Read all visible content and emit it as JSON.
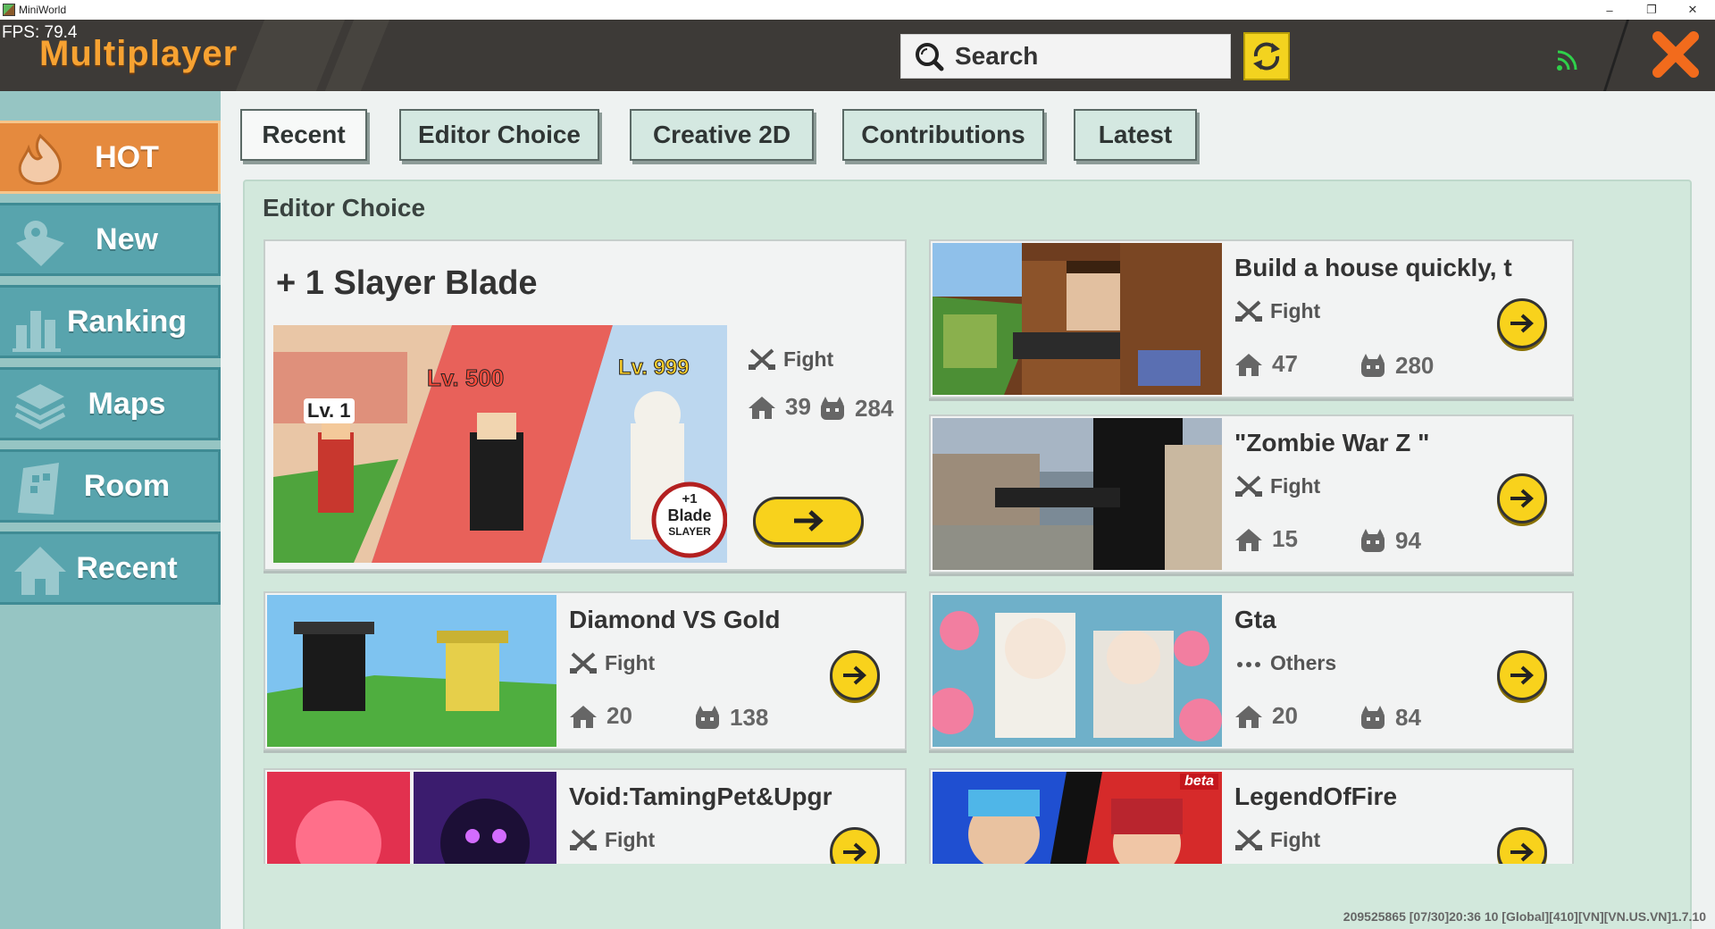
{
  "window": {
    "title": "MiniWorld",
    "minimize": "–",
    "restore": "❐",
    "close": "✕"
  },
  "header": {
    "fps": "FPS: 79.4",
    "title": "Multiplayer",
    "search_placeholder": "Search",
    "wifi_color": "#2fd04a",
    "close_color": "#f26b1c"
  },
  "sidebar": {
    "items": [
      {
        "label": "HOT",
        "icon": "fire-icon",
        "active": true
      },
      {
        "label": "New",
        "icon": "map-pin-icon"
      },
      {
        "label": "Ranking",
        "icon": "bar-chart-icon"
      },
      {
        "label": "Maps",
        "icon": "layers-icon"
      },
      {
        "label": "Room",
        "icon": "door-icon"
      },
      {
        "label": "Recent",
        "icon": "home-icon"
      }
    ]
  },
  "tabs": [
    "Recent",
    "Editor Choice",
    "Creative 2D",
    "Contributions",
    "Latest"
  ],
  "panel": {
    "title": "Editor Choice"
  },
  "featured": {
    "title": "+ 1 Slayer Blade",
    "tag": "Fight",
    "rooms": "39",
    "players": "284",
    "badges": [
      "Lv. 1",
      "Lv. 500",
      "Lv. 999"
    ],
    "image_text": [
      "+1",
      "Blade",
      "SLAYER"
    ]
  },
  "cards": [
    {
      "title": "Build a house quickly, t",
      "tag": "Fight",
      "tag_icon": "crossed-swords-icon",
      "rooms": "47",
      "players": "280"
    },
    {
      "title": "\"Zombie War Z \"",
      "tag": "Fight",
      "tag_icon": "crossed-swords-icon",
      "rooms": "15",
      "players": "94"
    },
    {
      "title": "Diamond VS Gold",
      "tag": "Fight",
      "tag_icon": "crossed-swords-icon",
      "rooms": "20",
      "players": "138"
    },
    {
      "title": "Gta",
      "tag": "Others",
      "tag_icon": "ellipsis-icon",
      "rooms": "20",
      "players": "84"
    },
    {
      "title": "Void:TamingPet&Upgr",
      "tag": "Fight",
      "tag_icon": "crossed-swords-icon"
    },
    {
      "title": "LegendOfFire",
      "tag": "Fight",
      "tag_icon": "crossed-swords-icon",
      "badge": "beta"
    }
  ],
  "footer": "209525865   [07/30]20:36 10  [Global][410][VN][VN.US.VN]1.7.10"
}
